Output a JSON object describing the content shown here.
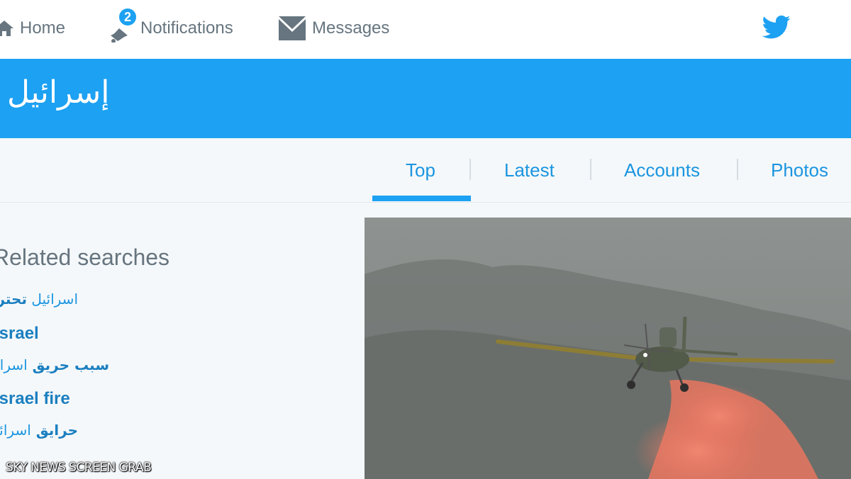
{
  "nav": {
    "home_label": "Home",
    "notifications_label": "Notifications",
    "notifications_count": "2",
    "messages_label": "Messages"
  },
  "banner": {
    "title": "إسرائيل"
  },
  "tabs": [
    {
      "label": "Top",
      "active": true
    },
    {
      "label": "Latest"
    },
    {
      "label": "Accounts"
    },
    {
      "label": "Photos"
    }
  ],
  "related": {
    "title": "Related searches",
    "items": [
      {
        "text_normal": "اسرائيل ",
        "text_bold": "تحترق"
      },
      {
        "text_bold": "Israel"
      },
      {
        "text_bold": "سبب حريق ",
        "text_normal": "اسرائيل"
      },
      {
        "text_bold": "Israel fire"
      },
      {
        "text_bold": "حرايق ",
        "text_normal": "اسرائيل"
      }
    ]
  },
  "watermark": "SKY NEWS SCREEN GRAB",
  "colors": {
    "brand": "#1da1f2",
    "link": "#1b95e0",
    "muted": "#66757f",
    "background": "#f5f8fa"
  }
}
